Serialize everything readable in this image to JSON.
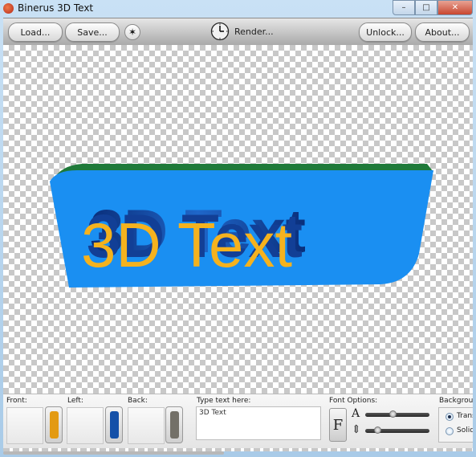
{
  "window": {
    "title": "Binerus 3D Text"
  },
  "window_controls": {
    "minimize": "–",
    "maximize": "□",
    "close": "✕"
  },
  "toolbar": {
    "load_label": "Load...",
    "save_label": "Save...",
    "star_glyph": "✶",
    "render_label": "Render...",
    "unlock_label": "Unlock...",
    "about_label": "About..."
  },
  "canvas": {
    "preview_text": "3D Text",
    "colors": {
      "front": "#f5b21e",
      "side": "#0e3f9c",
      "plate": "#1a8ff2",
      "plate_edge": "#1f7a3a"
    }
  },
  "panel": {
    "front_label": "Front:",
    "left_label": "Left:",
    "back_label": "Back:",
    "text_label": "Type text here:",
    "text_value": "3D Text",
    "font_options_label": "Font Options:",
    "font_button": "F",
    "size_icon": "A",
    "spacing_icon": "⇕",
    "size_slider_value": 0.42,
    "spacing_slider_value": 0.15,
    "background_label": "Background",
    "bg_options": [
      "Transparent",
      "Solid"
    ],
    "bg_selected": "Transparent",
    "colors": {
      "front": "#e39a12",
      "left": "#1450a8",
      "back": "#737068"
    }
  }
}
